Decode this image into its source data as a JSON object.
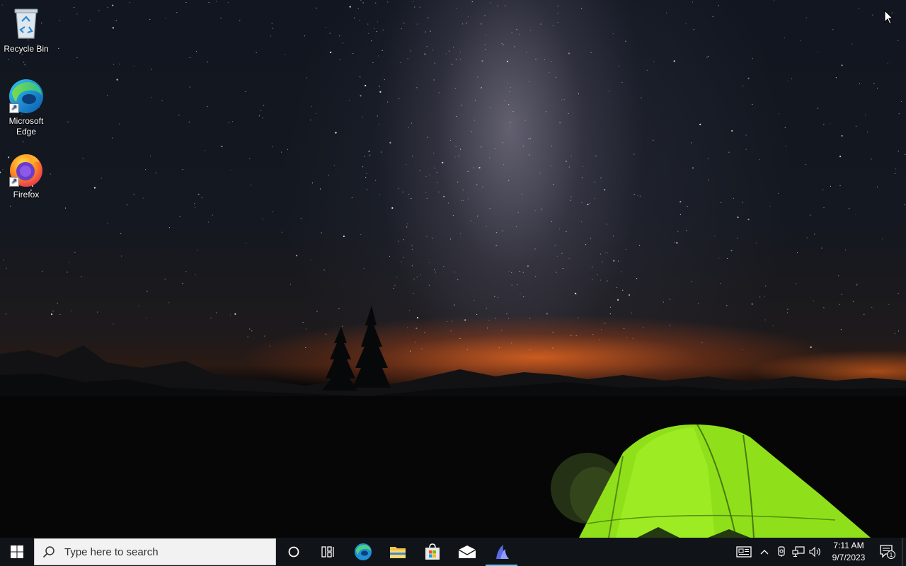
{
  "desktop": {
    "icons": [
      {
        "label": "Recycle Bin",
        "icon": "recycle-bin-icon"
      },
      {
        "label": "Microsoft Edge",
        "icon": "edge-icon"
      },
      {
        "label": "Firefox",
        "icon": "firefox-icon"
      }
    ]
  },
  "taskbar": {
    "search_placeholder": "Type here to search",
    "pinned": [
      {
        "icon": "cortana-icon"
      },
      {
        "icon": "task-view-icon"
      },
      {
        "icon": "edge-icon"
      },
      {
        "icon": "file-explorer-icon"
      },
      {
        "icon": "microsoft-store-icon"
      },
      {
        "icon": "mail-icon"
      },
      {
        "icon": "app-icon",
        "active": true
      }
    ],
    "tray": {
      "time": "7:11 AM",
      "date": "9/7/2023",
      "notification_count": "1"
    }
  },
  "colors": {
    "taskbar": "#101418",
    "active_indicator": "#76b9ed",
    "tent": "#8fe01a"
  }
}
